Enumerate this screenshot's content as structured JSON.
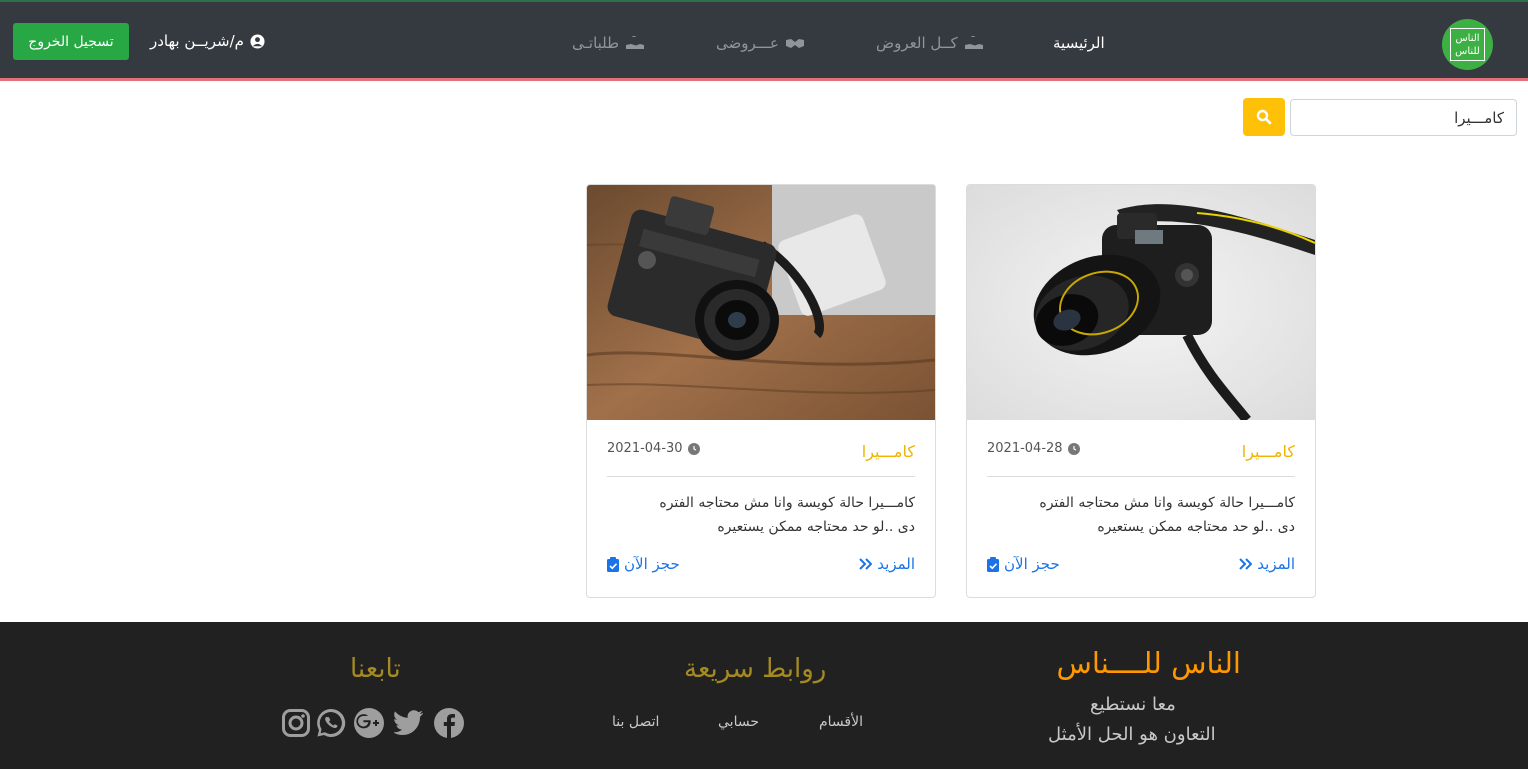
{
  "navbar": {
    "logo_line1": "الناس",
    "logo_line2": "للناس",
    "home": "الرئيسية",
    "all_offers": "كــل العروض",
    "my_offers": "عـــروضى",
    "my_requests": "طلباتـى",
    "user_name": "م/شريــن بهادر",
    "logout_label": "تسجيل الخروج"
  },
  "search": {
    "value": "كامـــيرا",
    "placeholder": ""
  },
  "cards": [
    {
      "category": "كامـــيرا",
      "date": "2021-04-28",
      "desc_line1": "كامـــيرا حالة كويسة وانا مش محتاجه الفتره",
      "desc_line2": "دى ..لو حد محتاجه ممكن يستعيره",
      "more": "المزيد",
      "book": "حجز الآن"
    },
    {
      "category": "كامـــيرا",
      "date": "2021-04-30",
      "desc_line1": "كامـــيرا حالة كويسة وانا مش محتاجه الفتره",
      "desc_line2": "دى ..لو حد محتاجه ممكن يستعيره",
      "more": "المزيد",
      "book": "حجز الآن"
    }
  ],
  "footer": {
    "brand": "الناس للــــناس",
    "tagline1": "معا نستطيع",
    "tagline2": "التعاون هو الحل الأمثل",
    "quick_links_title": "روابط سريعة",
    "links": [
      "الأقسام",
      "حسابي",
      "اتصل بنا"
    ],
    "follow_title": "تابعنا",
    "social": [
      "facebook-icon",
      "twitter-icon",
      "google-plus-icon",
      "whatsapp-icon",
      "instagram-icon"
    ]
  },
  "colors": {
    "navbar_bg": "#343a40",
    "accent_green": "#28a745",
    "search_yellow": "#ffc107",
    "category_gold": "#f0b400",
    "link_blue": "#1a73e8",
    "footer_bg": "#212121",
    "footer_brand": "#ff9800"
  }
}
